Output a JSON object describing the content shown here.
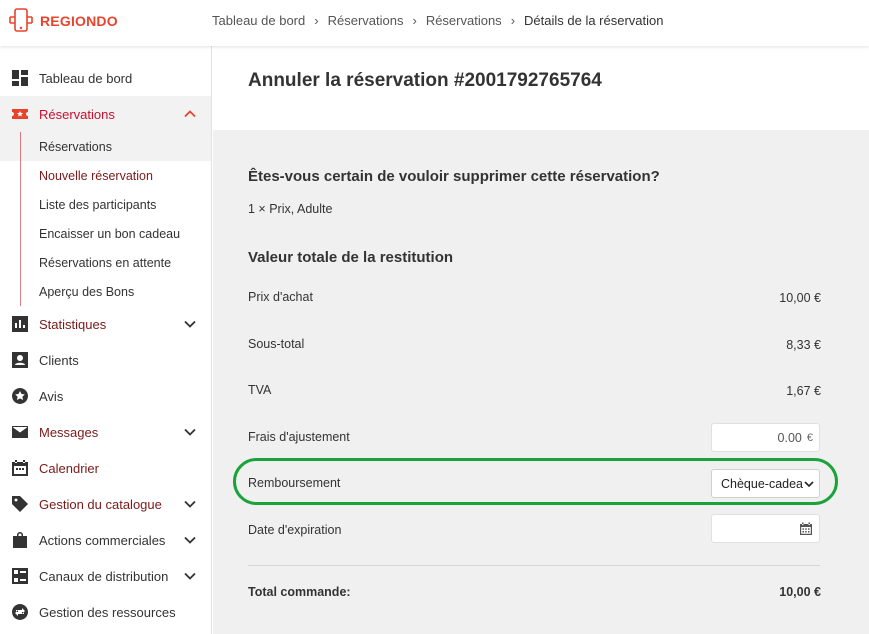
{
  "app": {
    "brand": "REGIONDO",
    "brand_color": "#e8442c",
    "accent_green": "#1aa33a"
  },
  "breadcrumb": [
    "Tableau de bord",
    "Réservations",
    "Réservations",
    "Détails de la réservation"
  ],
  "sidebar": {
    "items": [
      {
        "label": "Tableau de bord",
        "icon": "dashboard-icon"
      },
      {
        "label": "Réservations",
        "icon": "ticket-icon",
        "expanded": true
      },
      {
        "label": "Statistiques",
        "icon": "bar-chart-icon"
      },
      {
        "label": "Clients",
        "icon": "person-icon"
      },
      {
        "label": "Avis",
        "icon": "star-circle-icon"
      },
      {
        "label": "Messages",
        "icon": "mail-icon"
      },
      {
        "label": "Calendrier",
        "icon": "calendar-icon"
      },
      {
        "label": "Gestion du catalogue",
        "icon": "tag-icon"
      },
      {
        "label": "Actions commerciales",
        "icon": "bag-icon"
      },
      {
        "label": "Canaux de distribution",
        "icon": "channels-icon"
      },
      {
        "label": "Gestion des ressources",
        "icon": "swap-icon"
      }
    ],
    "sub_items": [
      "Réservations",
      "Nouvelle réservation",
      "Liste des participants",
      "Encaisser un bon cadeau",
      "Réservations en attente",
      "Aperçu des Bons"
    ]
  },
  "main": {
    "title": "Annuler la réservation #2001792765764",
    "question": "Êtes-vous certain de vouloir supprimer cette réservation?",
    "product": "1 × Prix, Adulte",
    "section_title": "Valeur totale de la restitution",
    "rows": {
      "purchase_label": "Prix d'achat",
      "purchase_value": "10,00 €",
      "subtotal_label": "Sous-total",
      "subtotal_value": "8,33 €",
      "vat_label": "TVA",
      "vat_value": "1,67 €",
      "fee_label": "Frais d'ajustement",
      "fee_value": "0.00",
      "fee_currency": "€",
      "refund_label": "Remboursement",
      "refund_selected": "Chèque-cadeau",
      "expiry_label": "Date d'expiration",
      "expiry_value": ""
    },
    "total_label": "Total commande:",
    "total_value": "10,00 €"
  }
}
